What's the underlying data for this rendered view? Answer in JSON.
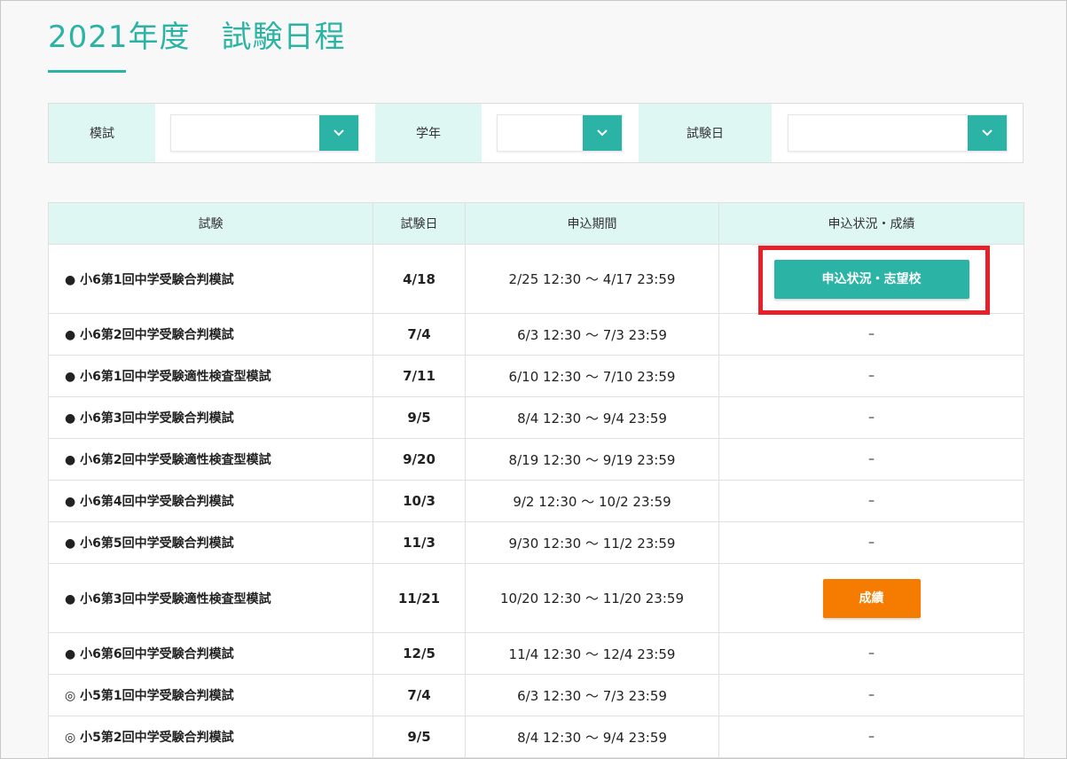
{
  "page": {
    "title": "2021年度　試験日程"
  },
  "filters": {
    "exam_label": "模試",
    "exam_value": "",
    "grade_label": "学年",
    "grade_value": "",
    "date_label": "試験日",
    "date_value": ""
  },
  "table": {
    "headers": [
      "試験",
      "試験日",
      "申込期間",
      "申込状況・成績"
    ],
    "rows": [
      {
        "name": "● 小6第1回中学受験合判模試",
        "date": "4/18",
        "period": "2/25 12:30 〜 4/17 23:59",
        "action": "申込状況・志望校",
        "action_type": "status"
      },
      {
        "name": "● 小6第2回中学受験合判模試",
        "date": "7/4",
        "period": "6/3 12:30 〜 7/3 23:59",
        "action": "–",
        "action_type": "none"
      },
      {
        "name": "● 小6第1回中学受験適性検査型模試",
        "date": "7/11",
        "period": "6/10 12:30 〜 7/10 23:59",
        "action": "–",
        "action_type": "none"
      },
      {
        "name": "● 小6第3回中学受験合判模試",
        "date": "9/5",
        "period": "8/4 12:30 〜 9/4 23:59",
        "action": "–",
        "action_type": "none"
      },
      {
        "name": "● 小6第2回中学受験適性検査型模試",
        "date": "9/20",
        "period": "8/19 12:30 〜 9/19 23:59",
        "action": "–",
        "action_type": "none"
      },
      {
        "name": "● 小6第4回中学受験合判模試",
        "date": "10/3",
        "period": "9/2 12:30 〜 10/2 23:59",
        "action": "–",
        "action_type": "none"
      },
      {
        "name": "● 小6第5回中学受験合判模試",
        "date": "11/3",
        "period": "9/30 12:30 〜 11/2 23:59",
        "action": "–",
        "action_type": "none"
      },
      {
        "name": "● 小6第3回中学受験適性検査型模試",
        "date": "11/21",
        "period": "10/20 12:30 〜 11/20 23:59",
        "action": "成績",
        "action_type": "results"
      },
      {
        "name": "● 小6第6回中学受験合判模試",
        "date": "12/5",
        "period": "11/4 12:30 〜 12/4 23:59",
        "action": "–",
        "action_type": "none"
      },
      {
        "name": "◎ 小5第1回中学受験合判模試",
        "date": "7/4",
        "period": "6/3 12:30 〜 7/3 23:59",
        "action": "–",
        "action_type": "none"
      },
      {
        "name": "◎ 小5第2回中学受験合判模試",
        "date": "9/5",
        "period": "8/4 12:30 〜 9/4 23:59",
        "action": "–",
        "action_type": "none"
      }
    ]
  },
  "colors": {
    "accent": "#2bb3a5",
    "header_bg": "#dff7f3",
    "results_button": "#f57c00",
    "highlight": "#e8202a"
  },
  "icons": {
    "dropdown": "chevron-down-icon"
  }
}
